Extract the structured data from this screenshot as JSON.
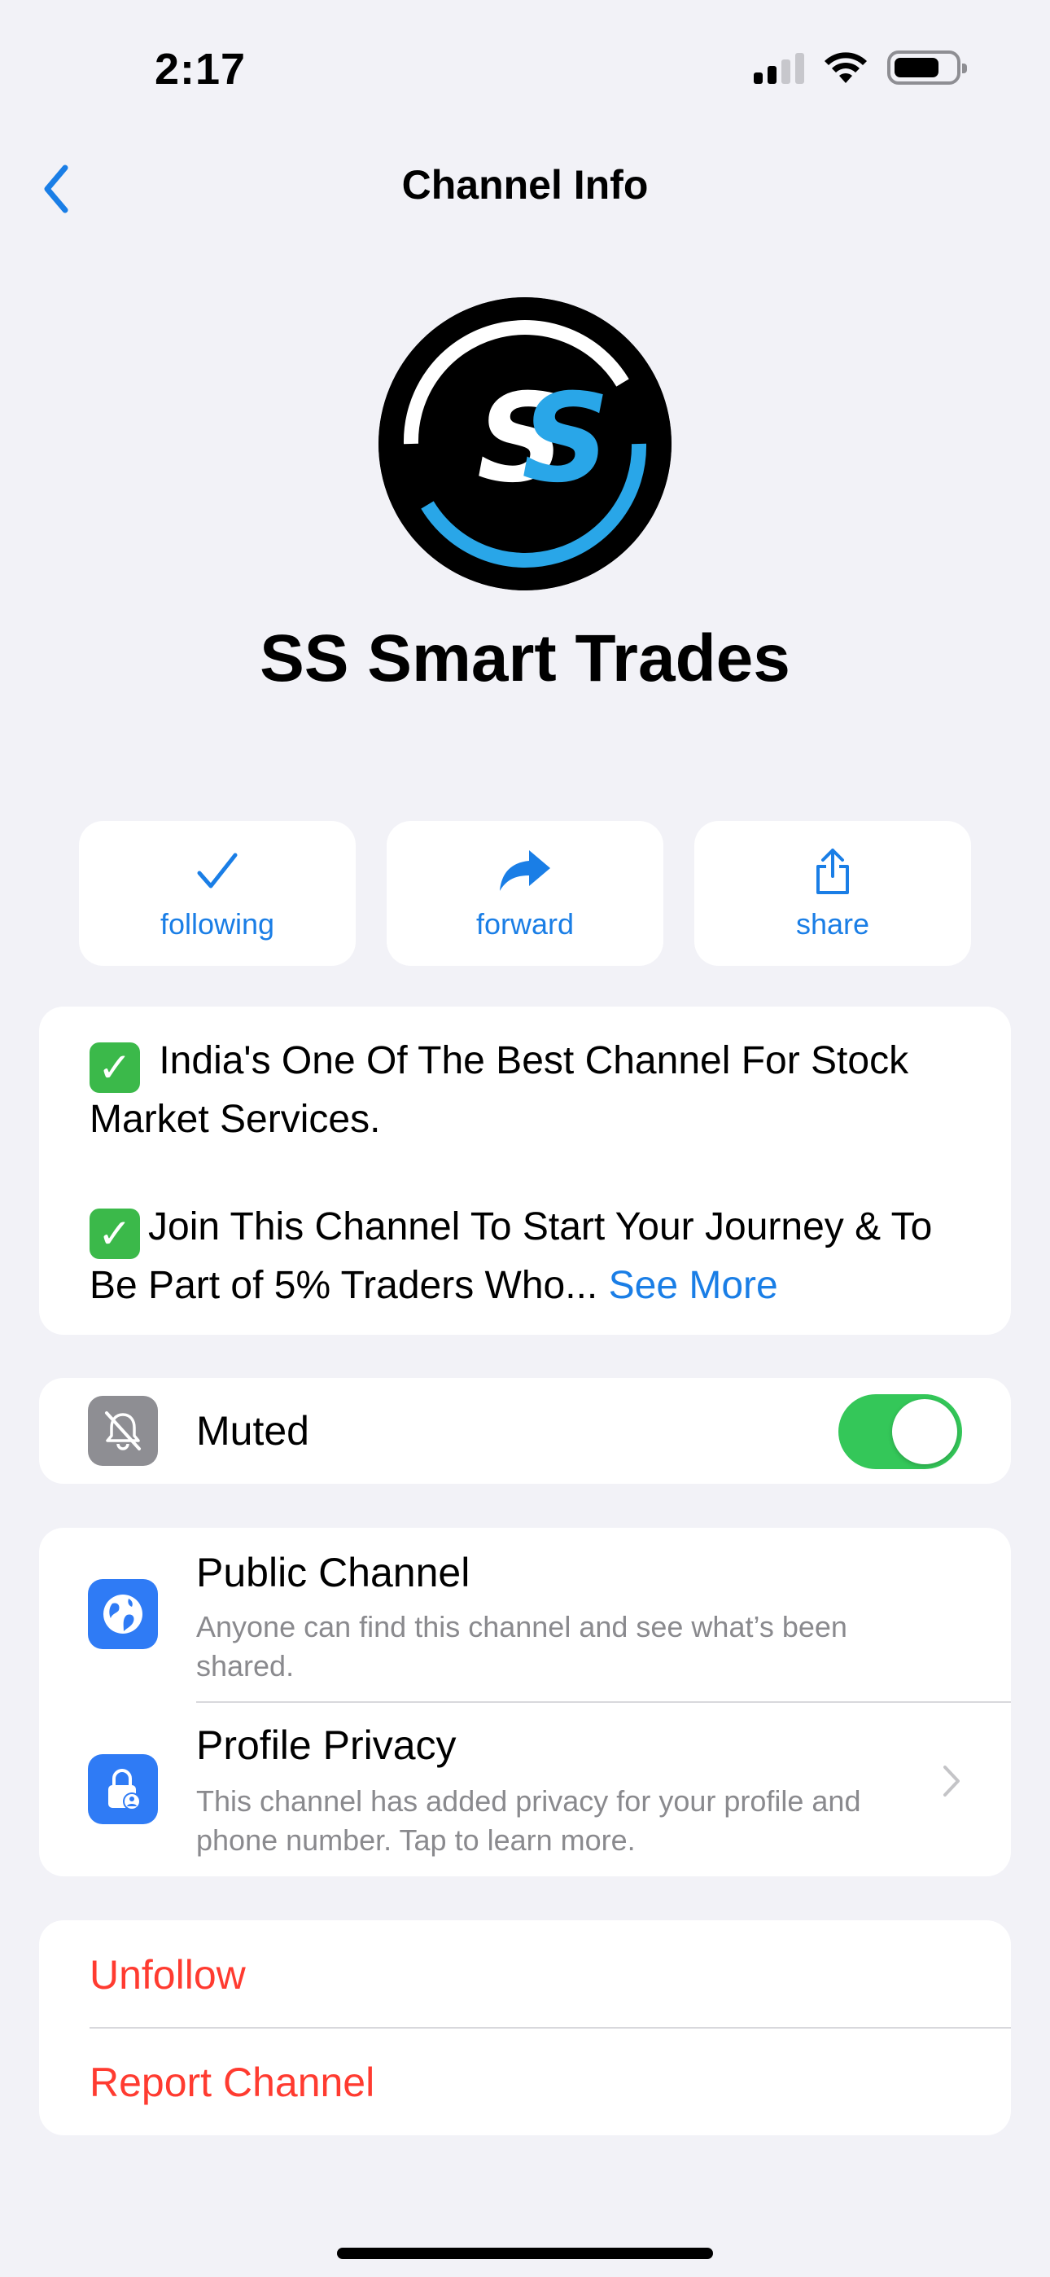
{
  "status_bar": {
    "time": "2:17",
    "signal_icon": "cellular-signal-icon",
    "wifi_icon": "wifi-icon",
    "battery_icon": "battery-icon",
    "battery_level": 0.7
  },
  "nav": {
    "back_icon": "chevron-left-icon",
    "title": "Channel Info"
  },
  "channel": {
    "avatar_text": "SS",
    "name": "SS Smart Trades"
  },
  "actions": [
    {
      "label": "following",
      "icon": "checkmark-icon"
    },
    {
      "label": "forward",
      "icon": "forward-arrow-icon"
    },
    {
      "label": "share",
      "icon": "share-icon"
    }
  ],
  "description": {
    "check_icon": "green-checkbox-icon",
    "line1": "India's One Of The Best Channel For Stock Market Services.",
    "line2": "Join This Channel To Start Your Journey & To Be Part of 5% Traders Who...",
    "see_more": "See More"
  },
  "mute": {
    "icon": "bell-slash-icon",
    "label": "Muted",
    "enabled": true
  },
  "privacy": {
    "public_channel": {
      "icon": "globe-icon",
      "title": "Public Channel",
      "subtitle": "Anyone can find this channel and see what’s been shared."
    },
    "profile_privacy": {
      "icon": "lock-person-icon",
      "title": "Profile Privacy",
      "subtitle": "This channel has added privacy for your profile and phone number. Tap to learn more.",
      "chevron": "chevron-right-icon"
    }
  },
  "danger": {
    "unfollow": "Unfollow",
    "report": "Report Channel"
  },
  "colors": {
    "accent": "#1a7ee6",
    "danger": "#ff3b30",
    "toggle_on": "#34c759",
    "background": "#f2f2f7",
    "logo_blue": "#29a6e8"
  }
}
